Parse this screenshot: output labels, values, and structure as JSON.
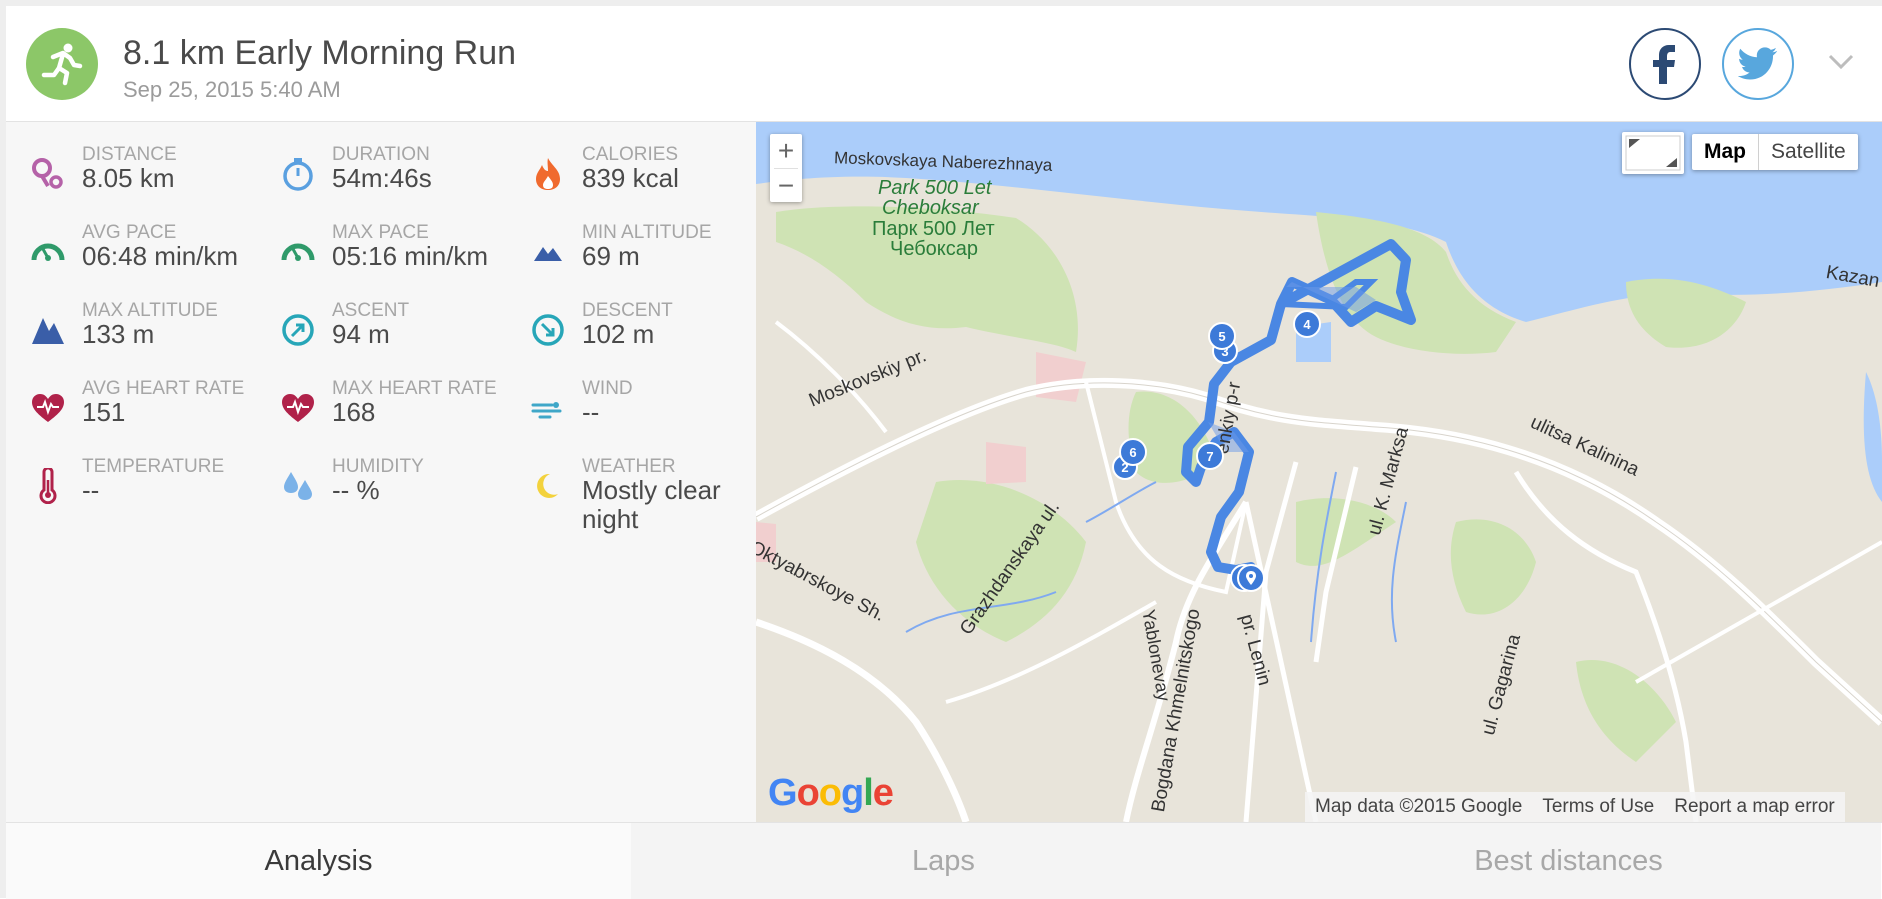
{
  "header": {
    "title": "8.1 km Early Morning Run",
    "subtitle": "Sep 25, 2015 5:40 AM",
    "activity_icon": "running-person-icon",
    "social": [
      "facebook-icon",
      "twitter-icon"
    ]
  },
  "stats": [
    {
      "label": "DISTANCE",
      "value": "8.05 km",
      "icon": "distance-pin-icon",
      "color": "#b562a8"
    },
    {
      "label": "DURATION",
      "value": "54m:46s",
      "icon": "stopwatch-icon",
      "color": "#5aa0e0"
    },
    {
      "label": "CALORIES",
      "value": "839 kcal",
      "icon": "flame-icon",
      "color": "#f06a2e"
    },
    {
      "label": "AVG PACE",
      "value": "06:48 min/km",
      "icon": "speedometer-icon",
      "color": "#2f9a6a"
    },
    {
      "label": "MAX PACE",
      "value": "05:16 min/km",
      "icon": "speedometer-icon",
      "color": "#2f9a6a"
    },
    {
      "label": "MIN ALTITUDE",
      "value": "69 m",
      "icon": "mountain-low-icon",
      "color": "#3a5ea8"
    },
    {
      "label": "MAX ALTITUDE",
      "value": "133 m",
      "icon": "mountain-high-icon",
      "color": "#3a5ea8"
    },
    {
      "label": "ASCENT",
      "value": "94 m",
      "icon": "ascent-arrow-icon",
      "color": "#27a6b8"
    },
    {
      "label": "DESCENT",
      "value": "102 m",
      "icon": "descent-arrow-icon",
      "color": "#27a6b8"
    },
    {
      "label": "AVG HEART RATE",
      "value": "151",
      "icon": "heart-rate-icon",
      "color": "#b0224a"
    },
    {
      "label": "MAX HEART RATE",
      "value": "168",
      "icon": "heart-rate-icon",
      "color": "#b0224a"
    },
    {
      "label": "WIND",
      "value": "--",
      "icon": "wind-icon",
      "color": "#3fa7c8"
    },
    {
      "label": "TEMPERATURE",
      "value": "--",
      "icon": "thermometer-icon",
      "color": "#b0224a"
    },
    {
      "label": "HUMIDITY",
      "value": "-- %",
      "icon": "water-drops-icon",
      "color": "#7bb2e8"
    },
    {
      "label": "WEATHER",
      "value": "Mostly clear night",
      "icon": "moon-icon",
      "color": "#f3d23d"
    }
  ],
  "map": {
    "zoom_in": "+",
    "zoom_out": "−",
    "map_type_options": [
      "Map",
      "Satellite"
    ],
    "selected_map_type": "Map",
    "google_logo": "Google",
    "attribution": {
      "data": "Map data ©2015 Google",
      "terms": "Terms of Use",
      "report": "Report a map error"
    },
    "labels": {
      "embankment": "Moskovskaya Naberezhnaya",
      "park_line1": "Park 500 Let",
      "park_line2": "Cheboksar",
      "park_ru1": "Парк 500 Лет",
      "park_ru2": "Чебоксар",
      "moskovskiy": "Moskovskiy pr.",
      "kalinina": "ulitsa Kalinina",
      "marksa": "ul. K. Marksa",
      "oktyabrskoye": "Oktyabrskoye Sh.",
      "grazhdanskaya": "Grazhdanskaya ul.",
      "khmelnitskogo": "Bogdana Khmelnitskogo",
      "yablonevaya": "Yablonevay",
      "lenina": "pr. Lenin",
      "gagarina": "ul. Gagarina",
      "kazan": "Kazan",
      "lenkiy": "enkiy p-r"
    },
    "route_markers": [
      "5",
      "3",
      "4",
      "6",
      "2",
      "7"
    ]
  },
  "tabs": [
    {
      "label": "Analysis",
      "active": true
    },
    {
      "label": "Laps",
      "active": false
    },
    {
      "label": "Best distances",
      "active": false
    }
  ]
}
